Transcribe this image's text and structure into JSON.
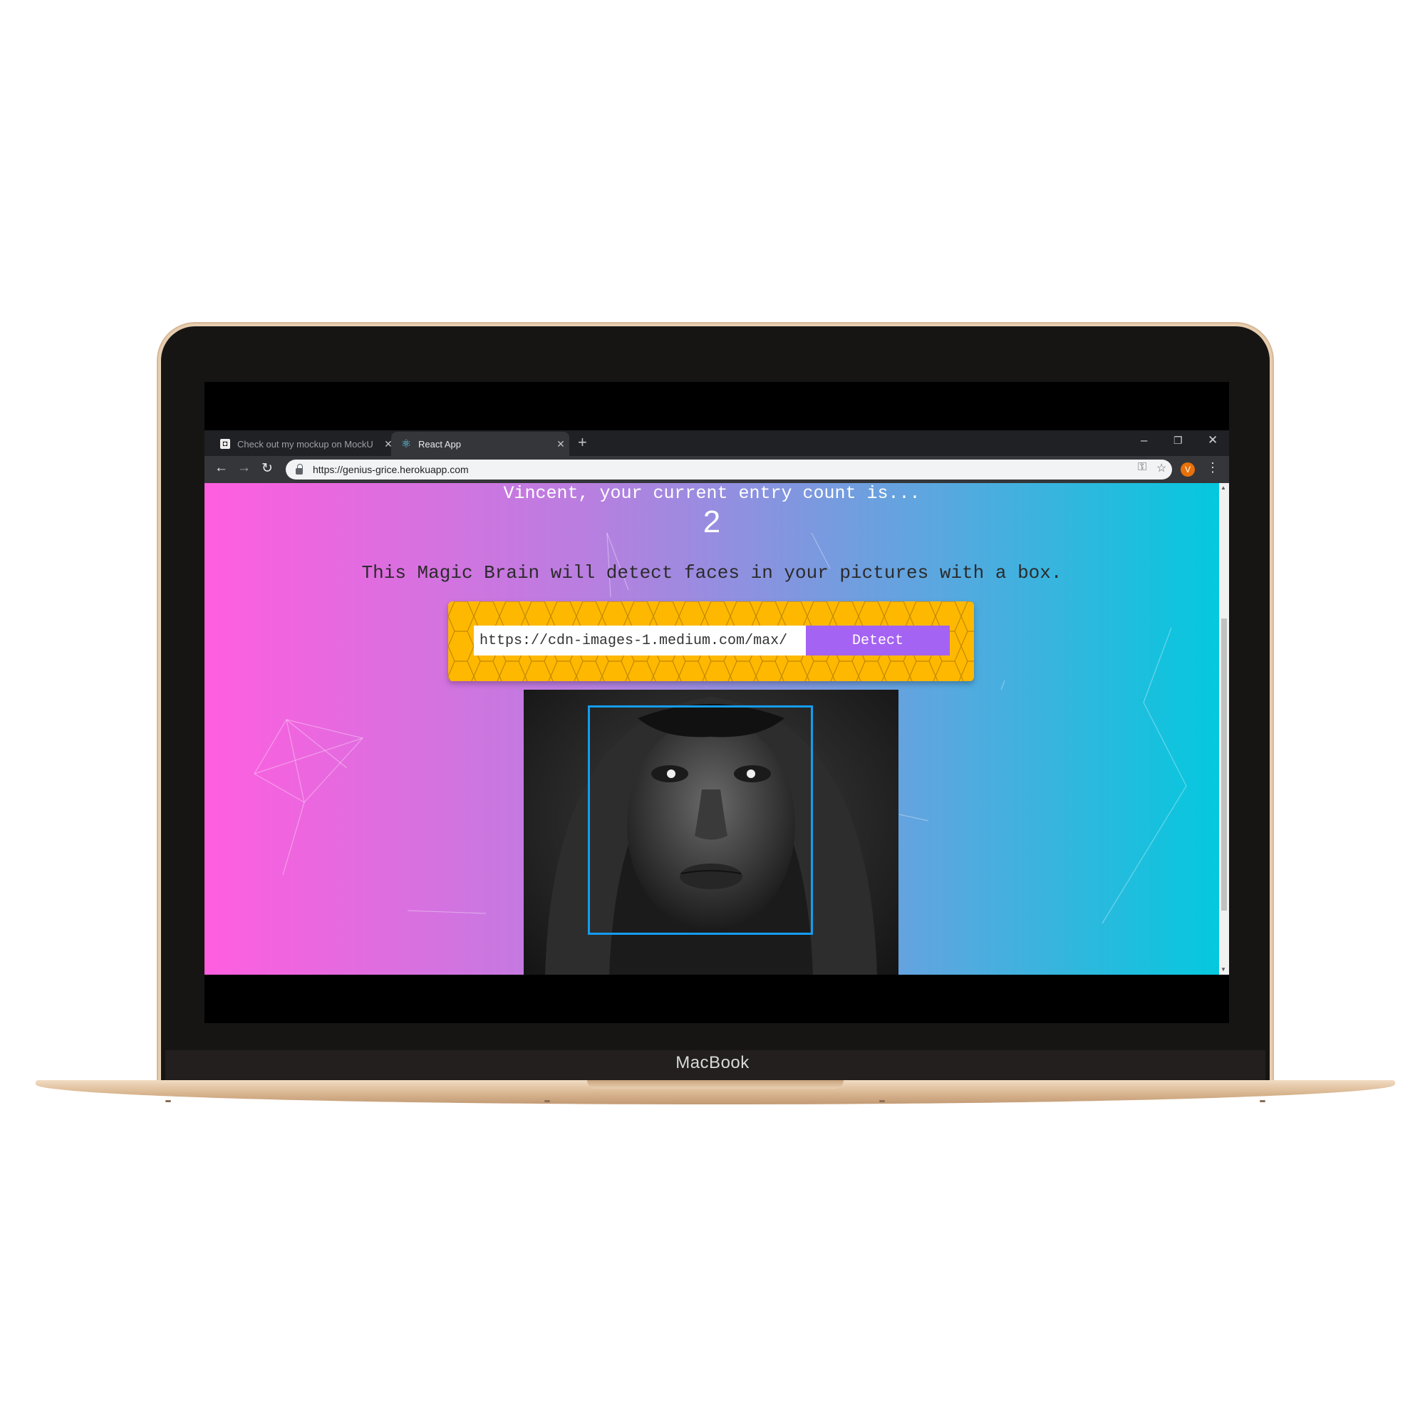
{
  "device": {
    "brand_label": "MacBook"
  },
  "browser": {
    "tabs": [
      {
        "title": "Check out my mockup on MockU",
        "active": false,
        "favicon": "mockup-favicon"
      },
      {
        "title": "React App",
        "active": true,
        "favicon": "react-icon"
      }
    ],
    "new_tab_glyph": "+",
    "window_controls": {
      "minimize": "–",
      "restore": "❐",
      "close": "✕"
    },
    "url": "https://genius-grice.herokuapp.com",
    "profile_initial": "V",
    "icons": {
      "back": "←",
      "forward": "→",
      "reload": "↻",
      "key": "⚿",
      "star": "☆",
      "menu": "⋮",
      "tab_close": "✕"
    }
  },
  "app": {
    "greeting": "Vincent, your current entry count is...",
    "entry_count": "2",
    "tagline": "This Magic Brain will detect faces in your pictures with a box.",
    "image_url_value": "https://cdn-images-1.medium.com/max/",
    "detect_label": "Detect",
    "colors": {
      "gradient_start": "#ff5edf",
      "gradient_end": "#04c8de",
      "form_background": "#ffb800",
      "detect_button": "#a463f2",
      "face_box": "#149df2"
    }
  }
}
